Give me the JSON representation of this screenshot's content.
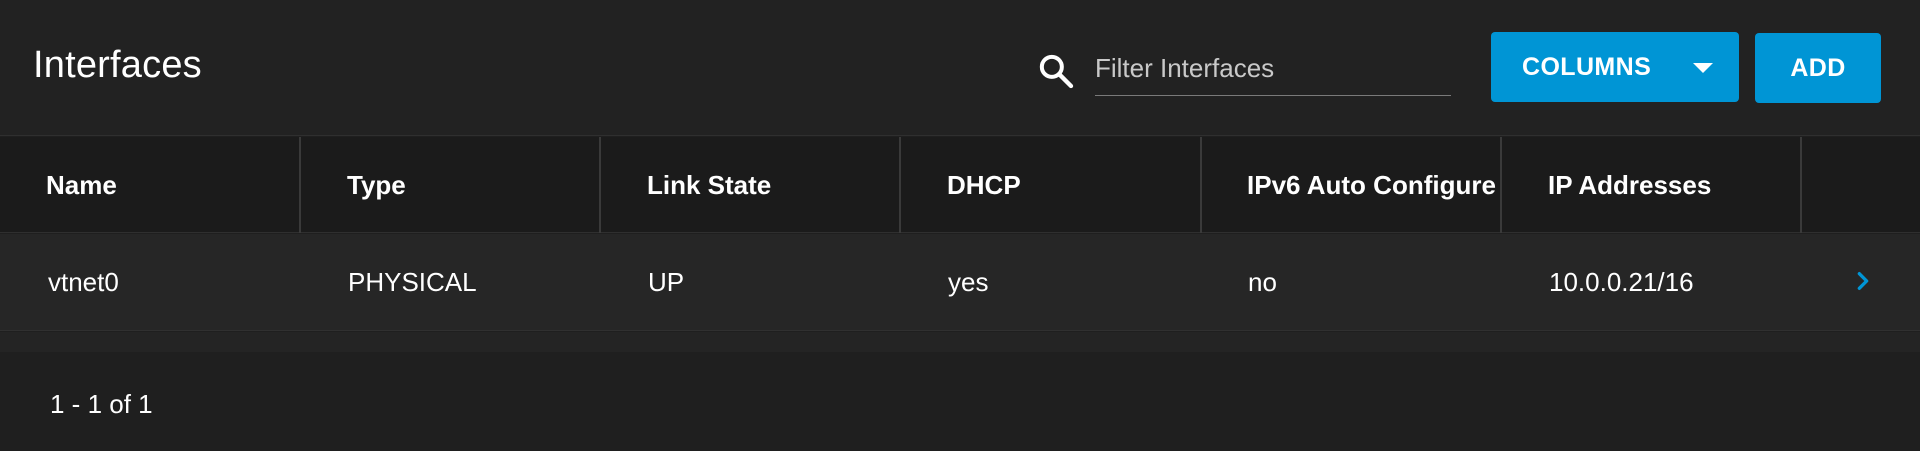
{
  "header": {
    "title": "Interfaces",
    "search_icon": "search-icon",
    "filter_placeholder": "Filter Interfaces",
    "filter_value": "",
    "columns_label": "COLUMNS",
    "add_label": "ADD"
  },
  "table": {
    "columns": [
      "Name",
      "Type",
      "Link State",
      "DHCP",
      "IPv6 Auto Configure",
      "IP Addresses"
    ],
    "rows": [
      {
        "name": "vtnet0",
        "type": "PHYSICAL",
        "link_state": "UP",
        "dhcp": "yes",
        "ipv6_auto_configure": "no",
        "ip_addresses": "10.0.0.21/16",
        "expand_icon": "chevron-right-icon"
      }
    ]
  },
  "footer": {
    "pagination": "1 - 1 of 1"
  },
  "colors": {
    "accent": "#0095d5",
    "background": "#1f1f1f",
    "header_background": "#222222",
    "row_background": "#262626"
  }
}
